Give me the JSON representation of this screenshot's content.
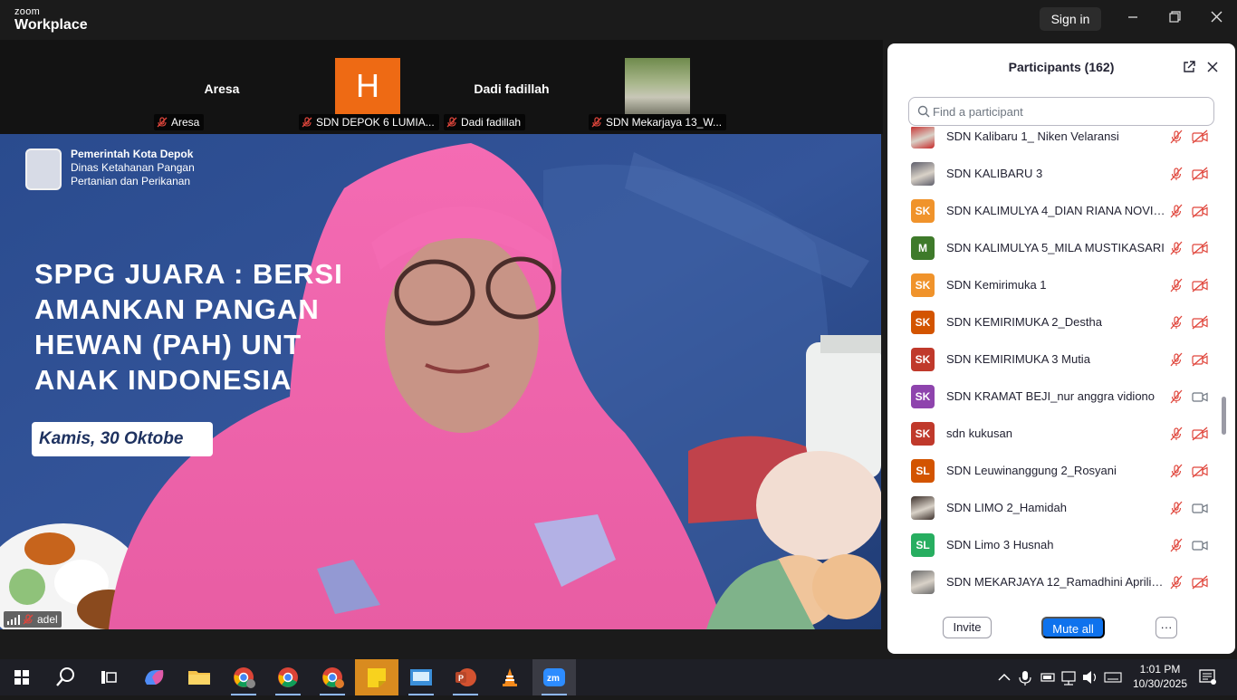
{
  "titlebar": {
    "brand_small": "zoom",
    "brand_big": "Workplace",
    "signin_label": "Sign in",
    "minimize_icon": "minimize-icon",
    "restore_icon": "restore-icon",
    "close_icon": "close-icon"
  },
  "gallery": [
    {
      "display": "Aresa",
      "label": "Aresa",
      "avatar": "none"
    },
    {
      "display": "H",
      "label": "SDN DEPOK 6 LUMIA...",
      "avatar": "letter",
      "color": "#ee6a14"
    },
    {
      "display": "Dadi fadillah",
      "label": "Dadi fadillah",
      "avatar": "none"
    },
    {
      "display": "",
      "label": "SDN Mekarjaya 13_W...",
      "avatar": "photo"
    }
  ],
  "video": {
    "org_line1": "Pemerintah Kota Depok",
    "org_line2": "Dinas Ketahanan Pangan",
    "org_line3": "Pertanian dan Perikanan",
    "slide_title": "SPPG JUARA : BERSI\nAMANKAN PANGAN\nHEWAN (PAH) UNT\nANAK INDONESIA",
    "date_text": "Kamis, 30 Oktobe",
    "speaker_label": "adel"
  },
  "panel": {
    "title": "Participants (162)",
    "search_placeholder": "Find a participant",
    "invite_label": "Invite",
    "mute_all_label": "Mute all",
    "more_label": "···",
    "participants": [
      {
        "name": "SDN Kalibaru 1_ Niken Velaransi",
        "avatar": "photo",
        "initials": "",
        "color": "#c62828",
        "cam": "off"
      },
      {
        "name": "SDN KALIBARU 3",
        "avatar": "photo",
        "initials": "",
        "color": "#5d5d6a",
        "cam": "off"
      },
      {
        "name": "SDN KALIMULYA 4_DIAN RIANA NOVITA...",
        "avatar": "initials",
        "initials": "SK",
        "color": "#f0932b",
        "cam": "off"
      },
      {
        "name": "SDN KALIMULYA 5_MILA MUSTIKASARI",
        "avatar": "initials",
        "initials": "M",
        "color": "#3e7a2a",
        "cam": "off"
      },
      {
        "name": "SDN Kemirimuka 1",
        "avatar": "initials",
        "initials": "SK",
        "color": "#f0932b",
        "cam": "off"
      },
      {
        "name": "SDN KEMIRIMUKA 2_Destha",
        "avatar": "initials",
        "initials": "SK",
        "color": "#d35400",
        "cam": "off"
      },
      {
        "name": "SDN KEMIRIMUKA 3 Mutia",
        "avatar": "initials",
        "initials": "SK",
        "color": "#c0392b",
        "cam": "off"
      },
      {
        "name": "SDN KRAMAT BEJI_nur anggra vidiono",
        "avatar": "initials",
        "initials": "SK",
        "color": "#8e44ad",
        "cam": "on"
      },
      {
        "name": "sdn kukusan",
        "avatar": "initials",
        "initials": "SK",
        "color": "#c0392b",
        "cam": "off"
      },
      {
        "name": "SDN Leuwinanggung 2_Rosyani",
        "avatar": "initials",
        "initials": "SL",
        "color": "#d35400",
        "cam": "off"
      },
      {
        "name": "SDN LIMO 2_Hamidah",
        "avatar": "photo",
        "initials": "",
        "color": "#3b2f2a",
        "cam": "on"
      },
      {
        "name": "SDN Limo 3 Husnah",
        "avatar": "initials",
        "initials": "SL",
        "color": "#27ae60",
        "cam": "on"
      },
      {
        "name": "SDN MEKARJAYA 12_Ramadhini Apriliani",
        "avatar": "photo",
        "initials": "",
        "color": "#6b6b6b",
        "cam": "off"
      }
    ]
  },
  "taskbar": {
    "apps": [
      "start-icon",
      "search-icon",
      "task-view-icon",
      "copilot-icon",
      "file-explorer-icon",
      "chrome-profile-icon",
      "chrome-icon",
      "chrome-alt-icon",
      "sticky-notes-icon",
      "app-icon",
      "powerpoint-icon",
      "vlc-icon",
      "zoom-icon"
    ],
    "time": "1:01 PM",
    "date": "10/30/2025"
  }
}
